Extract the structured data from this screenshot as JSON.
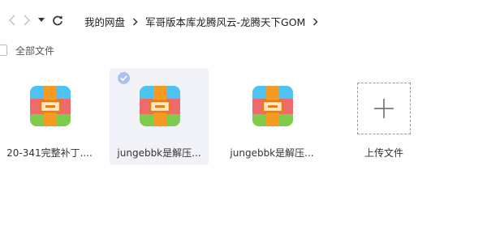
{
  "toolbar": {
    "back_icon": "chevron-left-icon",
    "forward_icon": "chevron-right-icon",
    "history_icon": "caret-down-icon",
    "refresh_icon": "refresh-icon",
    "breadcrumb": [
      "我的网盘",
      "军哥版本库龙腾风云-龙腾天下GOM"
    ]
  },
  "select_all": {
    "label": "全部文件",
    "checked": false
  },
  "files": [
    {
      "name": "20-341完整补丁....",
      "icon": "archive-icon",
      "selected": false
    },
    {
      "name": "jungebbk是解压...",
      "icon": "archive-icon",
      "selected": true
    },
    {
      "name": "jungebbk是解压...",
      "icon": "archive-icon",
      "selected": false
    }
  ],
  "upload": {
    "label": "上传文件",
    "icon": "plus-icon"
  },
  "colors": {
    "archive_top": "#4ec3f2",
    "archive_middle": "#ee6b6b",
    "archive_bottom": "#7dcc4b",
    "archive_strap": "#f59a23",
    "selected_bg": "#f2f3f8",
    "check_badge": "#a9c3ee"
  }
}
